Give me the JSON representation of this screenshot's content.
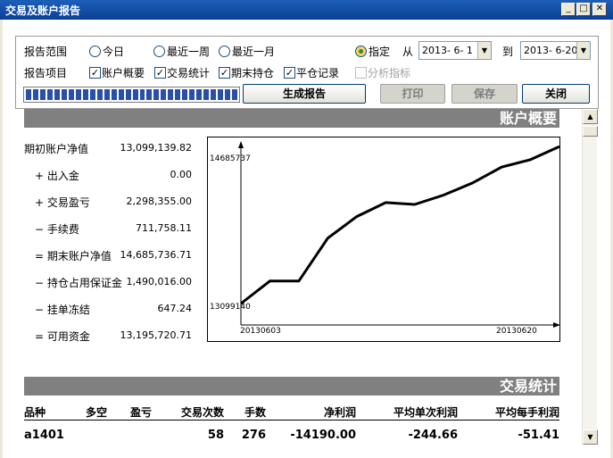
{
  "window": {
    "title": "交易及账户报告"
  },
  "toolbar": {
    "range_label": "报告范围",
    "range_options": [
      "今日",
      "最近一周",
      "最近一月",
      "指定"
    ],
    "from_label": "从",
    "from_date": "2013- 6- 1",
    "to_label": "到",
    "to_date": "2013- 6-20",
    "items_label": "报告项目",
    "items": [
      "账户概要",
      "交易统计",
      "期末持仓",
      "平仓记录"
    ],
    "analysis_label": "分析指标",
    "progress_percent": 100,
    "generate_button": "生成报告",
    "print_button": "打印",
    "save_button": "保存",
    "close_button": "关闭"
  },
  "account_summary": {
    "section_title": "账户概要",
    "rows": [
      {
        "label": "期初账户净值",
        "value": "13,099,139.82"
      },
      {
        "label": "+ 出入金",
        "value": "0.00"
      },
      {
        "label": "+ 交易盈亏",
        "value": "2,298,355.00"
      },
      {
        "label": "− 手续费",
        "value": "711,758.11"
      },
      {
        "label": "= 期末账户净值",
        "value": "14,685,736.71"
      },
      {
        "label": "− 持仓占用保证金",
        "value": "1,490,016.00"
      },
      {
        "label": "− 挂单冻结",
        "value": "647.24"
      },
      {
        "label": "= 可用资金",
        "value": "13,195,720.71"
      }
    ]
  },
  "chart_data": {
    "type": "line",
    "title": "",
    "xlabel": "",
    "ylabel": "",
    "x_tick_labels": [
      "20130603",
      "20130620"
    ],
    "y_tick_labels": [
      "14685737",
      "13099140"
    ],
    "ylim": [
      13099140,
      14685737
    ],
    "series": [
      {
        "values": [
          13099140,
          13340000,
          13340000,
          13800000,
          14030000,
          14180000,
          14160000,
          14260000,
          14390000,
          14560000,
          14640000,
          14780000
        ]
      }
    ],
    "grid": false
  },
  "trade_stats": {
    "section_title": "交易统计",
    "columns": [
      "品种",
      "多空",
      "盈亏",
      "交易次数",
      "手数",
      "净利润",
      "平均单次利润",
      "平均每手利润"
    ],
    "rows": [
      [
        "a1401",
        "",
        "",
        "58",
        "276",
        "-14190.00",
        "-244.66",
        "-51.41"
      ]
    ]
  }
}
